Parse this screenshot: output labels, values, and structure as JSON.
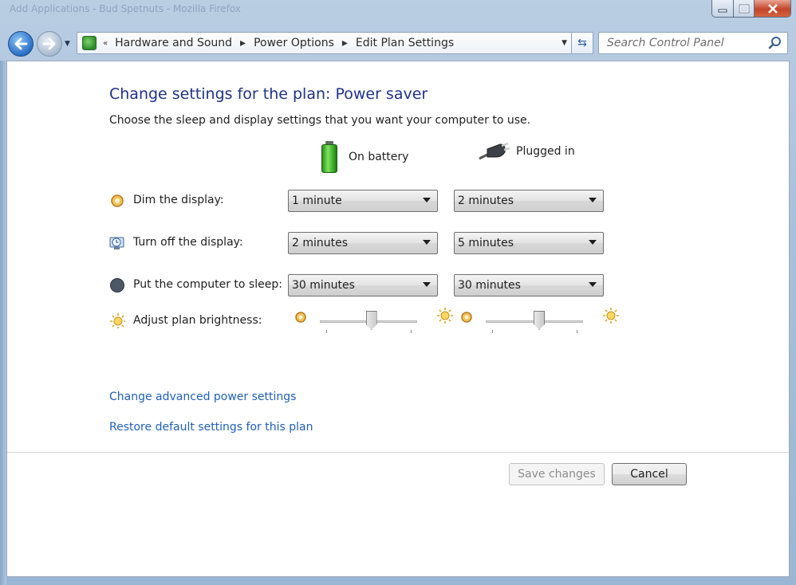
{
  "window": {
    "ghost_title": "Add Applications  -  Bud Spetnuts  -  Mozilla Firefox"
  },
  "navigation": {
    "breadcrumbs": [
      "Hardware and Sound",
      "Power Options",
      "Edit Plan Settings"
    ],
    "search_placeholder": "Search Control Panel"
  },
  "page": {
    "title": "Change settings for the plan: Power saver",
    "subtitle": "Choose the sleep and display settings that you want your computer to use."
  },
  "columns": {
    "battery": "On battery",
    "plugged": "Plugged in"
  },
  "settings": [
    {
      "label": "Dim the display:",
      "icon": "dim-icon",
      "battery": "1 minute",
      "plugged": "2 minutes"
    },
    {
      "label": "Turn off the display:",
      "icon": "monitor-clock-icon",
      "battery": "2 minutes",
      "plugged": "5 minutes"
    },
    {
      "label": "Put the computer to sleep:",
      "icon": "moon-icon",
      "battery": "30 minutes",
      "plugged": "30 minutes"
    }
  ],
  "brightness": {
    "label": "Adjust plan brightness:",
    "battery_level": 0.53,
    "plugged_level": 0.55
  },
  "links": {
    "advanced": "Change advanced power settings",
    "restore": "Restore default settings for this plan"
  },
  "buttons": {
    "save": "Save changes",
    "cancel": "Cancel"
  },
  "colors": {
    "title": "#1e3287",
    "link": "#1f5fbb",
    "close_button": "#c3452a"
  }
}
